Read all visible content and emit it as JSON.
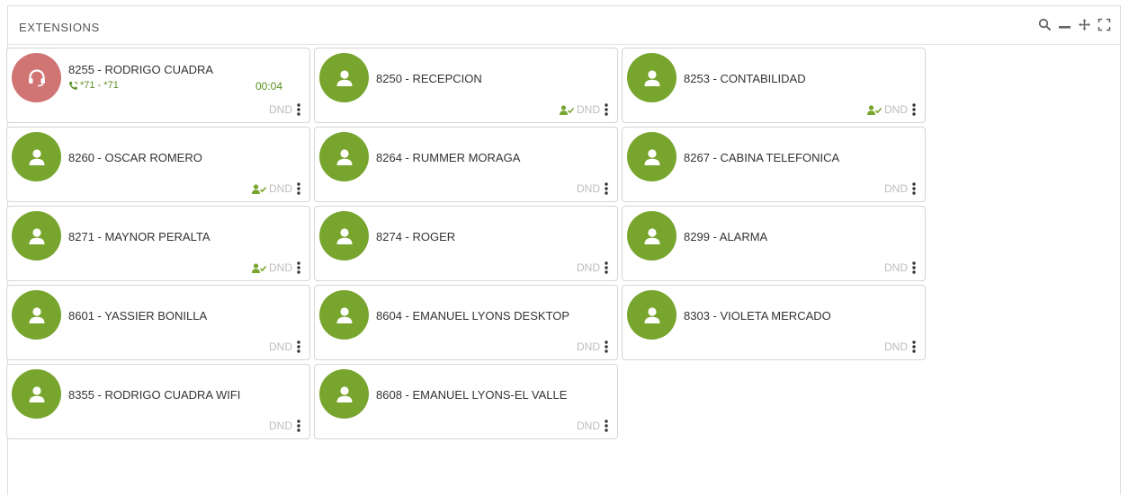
{
  "panel": {
    "title": "EXTENSIONS",
    "tools": [
      "search-icon",
      "minimize-icon",
      "move-icon",
      "fullscreen-icon"
    ]
  },
  "colors": {
    "available": "#78a52e",
    "busy": "#d07474",
    "call_text": "#5b8f22",
    "dnd_text": "#bdbdbd"
  },
  "extensions": [
    {
      "label": "8255 - RODRIGO CUADRA",
      "status": "busy",
      "avatar_icon": "headset-icon",
      "call": {
        "label": "*71 - *71",
        "timer": "00:04"
      },
      "presence": false,
      "dnd": "DND"
    },
    {
      "label": "8250 - RECEPCION",
      "status": "available",
      "avatar_icon": "user-icon",
      "presence": true,
      "dnd": "DND"
    },
    {
      "label": "8253 - CONTABILIDAD",
      "status": "available",
      "avatar_icon": "user-icon",
      "presence": true,
      "dnd": "DND"
    },
    {
      "label": "8260 - OSCAR ROMERO",
      "status": "available",
      "avatar_icon": "user-icon",
      "presence": true,
      "dnd": "DND"
    },
    {
      "label": "8264 - RUMMER MORAGA",
      "status": "available",
      "avatar_icon": "user-icon",
      "presence": false,
      "dnd": "DND"
    },
    {
      "label": "8267 - CABINA TELEFONICA",
      "status": "available",
      "avatar_icon": "user-icon",
      "presence": false,
      "dnd": "DND"
    },
    {
      "label": "8271 - MAYNOR PERALTA",
      "status": "available",
      "avatar_icon": "user-icon",
      "presence": true,
      "dnd": "DND"
    },
    {
      "label": "8274 - ROGER",
      "status": "available",
      "avatar_icon": "user-icon",
      "presence": false,
      "dnd": "DND"
    },
    {
      "label": "8299 - ALARMA",
      "status": "available",
      "avatar_icon": "user-icon",
      "presence": false,
      "dnd": "DND"
    },
    {
      "label": "8601 - YASSIER BONILLA",
      "status": "available",
      "avatar_icon": "user-icon",
      "presence": false,
      "dnd": "DND"
    },
    {
      "label": "8604 - EMANUEL LYONS DESKTOP",
      "status": "available",
      "avatar_icon": "user-icon",
      "presence": false,
      "dnd": "DND"
    },
    {
      "label": "8303 - VIOLETA MERCADO",
      "status": "available",
      "avatar_icon": "user-icon",
      "presence": false,
      "dnd": "DND"
    },
    {
      "label": "8355 - RODRIGO CUADRA WIFI",
      "status": "available",
      "avatar_icon": "user-icon",
      "presence": false,
      "dnd": "DND"
    },
    {
      "label": "8608 - EMANUEL LYONS-EL VALLE",
      "status": "available",
      "avatar_icon": "user-icon",
      "presence": false,
      "dnd": "DND"
    }
  ]
}
